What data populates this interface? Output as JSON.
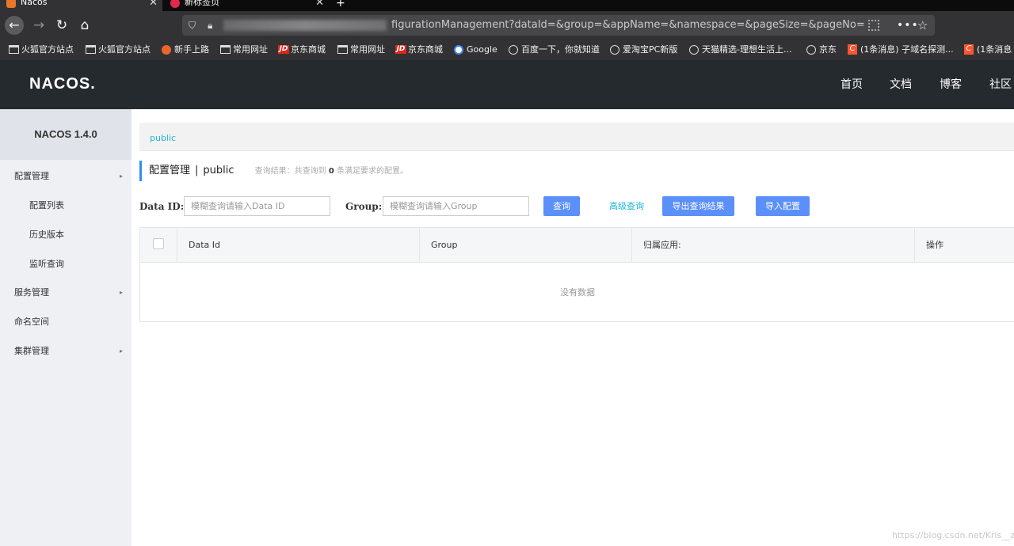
{
  "browser": {
    "tabs": [
      {
        "title": "Nacos"
      },
      {
        "title": "新标签页"
      }
    ],
    "url": "figurationManagement?dataId=&group=&appName=&namespace=&pageSize=&pageNo=",
    "bookmarks": [
      {
        "label": "火狐官方站点",
        "icon": "folder-icon"
      },
      {
        "label": "火狐官方站点",
        "icon": "folder-icon"
      },
      {
        "label": "新手上路",
        "icon": "firefox-icon"
      },
      {
        "label": "常用网址",
        "icon": "folder-icon"
      },
      {
        "label": "京东商城",
        "icon": "jd-icon",
        "badge": "JD"
      },
      {
        "label": "常用网址",
        "icon": "folder-icon"
      },
      {
        "label": "京东商城",
        "icon": "jd-icon",
        "badge": "JD"
      },
      {
        "label": "Google",
        "icon": "google-icon"
      },
      {
        "label": "百度一下，你就知道",
        "icon": "globe-icon"
      },
      {
        "label": "爱淘宝PC新版",
        "icon": "globe-icon"
      },
      {
        "label": "天猫精选-理想生活上...",
        "icon": "globe-icon"
      },
      {
        "label": "京东",
        "icon": "globe-icon"
      },
      {
        "label": "(1条消息) 子域名探测...",
        "icon": "csdn-icon",
        "badge": "C"
      },
      {
        "label": "(1条消息",
        "icon": "csdn-icon",
        "badge": "C"
      }
    ]
  },
  "header": {
    "logo": "NACOS.",
    "nav": [
      "首页",
      "文档",
      "博客",
      "社区"
    ]
  },
  "sidebar": {
    "title": "NACOS 1.4.0",
    "items": [
      {
        "label": "配置管理",
        "expandable": true
      },
      {
        "label": "配置列表",
        "sub": true
      },
      {
        "label": "历史版本",
        "sub": true
      },
      {
        "label": "监听查询",
        "sub": true
      },
      {
        "label": "服务管理",
        "expandable": true
      },
      {
        "label": "命名空间",
        "expandable": false
      },
      {
        "label": "集群管理",
        "expandable": true
      }
    ]
  },
  "main": {
    "namespace": "public",
    "title": "配置管理",
    "separator": "|",
    "title_namespace": "public",
    "result_prefix": "查询结果：共查询到",
    "result_count": "0",
    "result_suffix": "条满足要求的配置。",
    "filters": {
      "dataid_label": "Data ID:",
      "dataid_placeholder": "模糊查询请输入Data ID",
      "group_label": "Group:",
      "group_placeholder": "模糊查询请输入Group"
    },
    "buttons": {
      "query": "查询",
      "advanced": "高级查询",
      "export": "导出查询结果",
      "import": "导入配置"
    },
    "table": {
      "columns": [
        "Data Id",
        "Group",
        "归属应用:",
        "操作"
      ],
      "empty_text": "没有数据"
    }
  },
  "watermark": "https://blog.csdn.net/Kris__zhang",
  "colors": {
    "header_bg": "#252a2f",
    "sidebar_bg": "#eef0f4",
    "primary": "#5b8ff9",
    "link": "#1fb6d8",
    "title_accent": "#2f8ff3"
  }
}
